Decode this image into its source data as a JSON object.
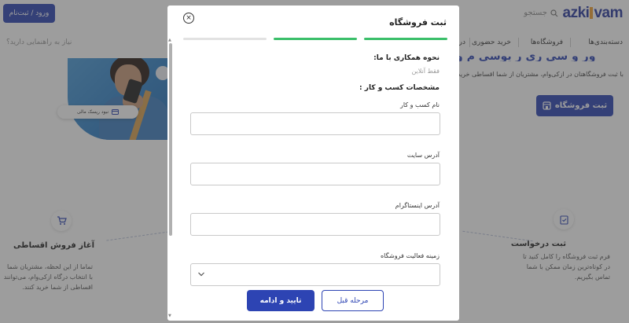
{
  "header": {
    "brand_prefix": "azki",
    "brand_suffix": "vam",
    "search_placeholder": "جستجو",
    "login_label": "ورود / ثبت‌نام"
  },
  "nav": {
    "items": [
      "دسته‌بندی‌ها",
      "فروشگاه‌ها",
      "خرید حضوری",
      "در"
    ],
    "help_text": "نیاز به راهنمایی دارید؟"
  },
  "hero": {
    "title": "ور و سی ری ر یوسی م و",
    "subtitle": "با ثبت فروشگاهتان در ازکی‌وام، مشتریان از شما اقساطی خرید می‌کنند",
    "register_label": "ثبت فروشگاه",
    "chip_label": "نبود ریسک مالی"
  },
  "steps": {
    "left": {
      "title": "آغاز فروش اقساطی",
      "text": "تماما از این لحظه، مشتریان شما\nبا انتخاب درگاه ازکی‌وام، می‌توانند\nاقساطی از شما خرید کنند."
    },
    "right": {
      "title": "ثبت درخواست",
      "text": "فرم ثبت فروشگاه را کامل کنید تا\nدر کوتاه‌ترین زمان ممکن با شما\nتماس بگیریم."
    }
  },
  "modal": {
    "title": "ثبت فروشگاه",
    "close_symbol": "×",
    "progress_colors": {
      "done": "#3bbf6a",
      "todo": "#e2e2e2"
    },
    "collab_label": "نحوه همکاری با ما:",
    "collab_value": "فقط آنلاین",
    "section_title": "مشخصات کسب و کار :",
    "fields": {
      "business_name": {
        "label": "نام کسب و کار",
        "value": ""
      },
      "website": {
        "label": "آدرس سایت",
        "value": ""
      },
      "instagram": {
        "label": "آدرس اینستاگرام",
        "value": ""
      },
      "activity": {
        "label": "زمینه فعالیت فروشگاه",
        "value": ""
      }
    },
    "next_label": "تایید و ادامه",
    "prev_label": "مرحله قبل"
  },
  "colors": {
    "primary": "#2d44b3",
    "accent": "#f0a030",
    "success": "#3bbf6a"
  }
}
